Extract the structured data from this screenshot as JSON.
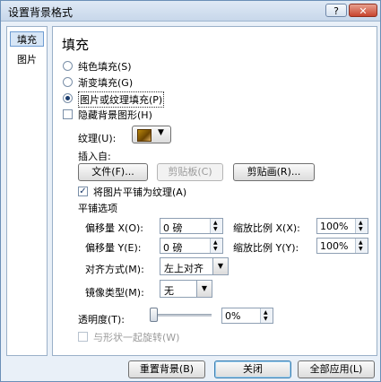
{
  "window": {
    "title": "设置背景格式",
    "help_glyph": "?",
    "close_glyph": "✕"
  },
  "sidebar": {
    "items": [
      {
        "label": "填充",
        "selected": true
      },
      {
        "label": "图片",
        "selected": false
      }
    ]
  },
  "fill": {
    "heading": "填充",
    "options": [
      {
        "label": "纯色填充(S)",
        "selected": false
      },
      {
        "label": "渐变填充(G)",
        "selected": false
      },
      {
        "label": "图片或纹理填充(P)",
        "selected": true
      }
    ],
    "hide_bg_label": "隐藏背景图形(H)",
    "texture_label": "纹理(U):",
    "texture_arrow": "▼",
    "insert_from_label": "插入自:",
    "file_button": "文件(F)...",
    "clipboard_button": "剪贴板(C)",
    "clipart_button": "剪贴画(R)...",
    "tile_checkbox_label": "将图片平铺为纹理(A)",
    "tile_checkmark": "✓",
    "tile_options_label": "平铺选项",
    "offset_x_label": "偏移量 X(O):",
    "offset_x_value": "0 磅",
    "offset_y_label": "偏移量 Y(E):",
    "offset_y_value": "0 磅",
    "scale_x_label": "缩放比例 X(X):",
    "scale_x_value": "100%",
    "scale_y_label": "缩放比例 Y(Y):",
    "scale_y_value": "100%",
    "align_label": "对齐方式(M):",
    "align_value": "左上对齐",
    "mirror_label": "镜像类型(M):",
    "mirror_value": "无",
    "transparency_label": "透明度(T):",
    "transparency_value": "0%",
    "transparency_fraction": 0,
    "rotate_label": "与形状一起旋转(W)",
    "spin_up": "▲",
    "spin_down": "▼",
    "drop_arrow": "▼"
  },
  "footer": {
    "reset_button": "重置背景(B)",
    "close_button": "关闭",
    "apply_all_button": "全部应用(L)"
  }
}
